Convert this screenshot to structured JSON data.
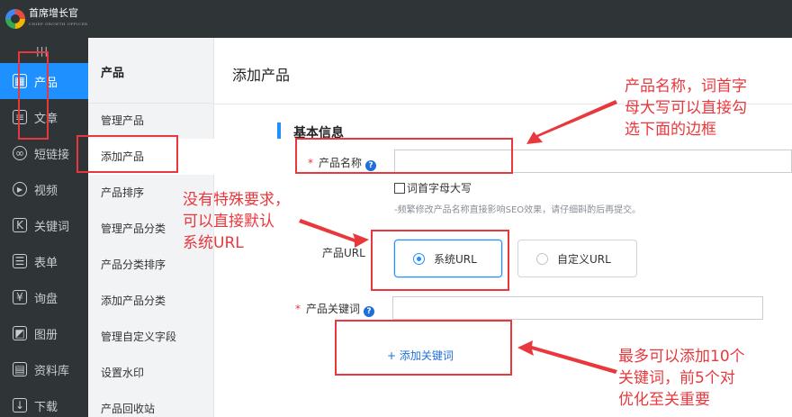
{
  "logo": {
    "title": "首席增长官",
    "subtitle": "CHIEF GROWTH OFFICER"
  },
  "nav": {
    "collapse_label": "|||",
    "items": [
      {
        "label": "产品",
        "icon": "grid-icon"
      },
      {
        "label": "文章",
        "icon": "document-icon"
      },
      {
        "label": "短链接",
        "icon": "link-icon"
      },
      {
        "label": "视频",
        "icon": "play-icon"
      },
      {
        "label": "关键词",
        "icon": "k-icon"
      },
      {
        "label": "表单",
        "icon": "clipboard-icon"
      },
      {
        "label": "询盘",
        "icon": "inquiry-icon"
      },
      {
        "label": "图册",
        "icon": "album-icon"
      },
      {
        "label": "资料库",
        "icon": "library-icon"
      },
      {
        "label": "下载",
        "icon": "download-icon"
      }
    ]
  },
  "subnav": {
    "title": "产品",
    "items": [
      {
        "label": "管理产品"
      },
      {
        "label": "添加产品"
      },
      {
        "label": "产品排序"
      },
      {
        "label": "管理产品分类"
      },
      {
        "label": "产品分类排序"
      },
      {
        "label": "添加产品分类"
      },
      {
        "label": "管理自定义字段"
      },
      {
        "label": "设置水印"
      },
      {
        "label": "产品回收站"
      }
    ]
  },
  "main": {
    "title": "添加产品",
    "section_title": "基本信息",
    "product_name": {
      "label": "产品名称",
      "required_mark": "*",
      "help": "?",
      "value": ""
    },
    "capitalize_checkbox": {
      "label": "词首字母大写",
      "checked": false
    },
    "hint": "-频繁修改产品名称直接影响SEO效果，请仔细斟酌后再提交。",
    "url": {
      "label": "产品URL",
      "options": [
        {
          "label": "系统URL",
          "selected": true
        },
        {
          "label": "自定义URL",
          "selected": false
        }
      ]
    },
    "keywords": {
      "label": "产品关键词",
      "required_mark": "*",
      "help": "?",
      "value": "",
      "add_label": "+ 添加关键词"
    }
  },
  "annotations": {
    "note1": [
      "产品名称，词首字",
      "母大写可以直接勾",
      "选下面的边框"
    ],
    "note2": [
      "没有特殊要求，",
      "可以直接默认",
      "系统URL"
    ],
    "note3": [
      "最多可以添加10个",
      "关键词，前5个对",
      "优化至关重要"
    ],
    "color": "#e8383d"
  },
  "colors": {
    "accent": "#1e90ff",
    "nav_bg": "#2f3437",
    "subnav_bg": "#f2f3f5"
  }
}
